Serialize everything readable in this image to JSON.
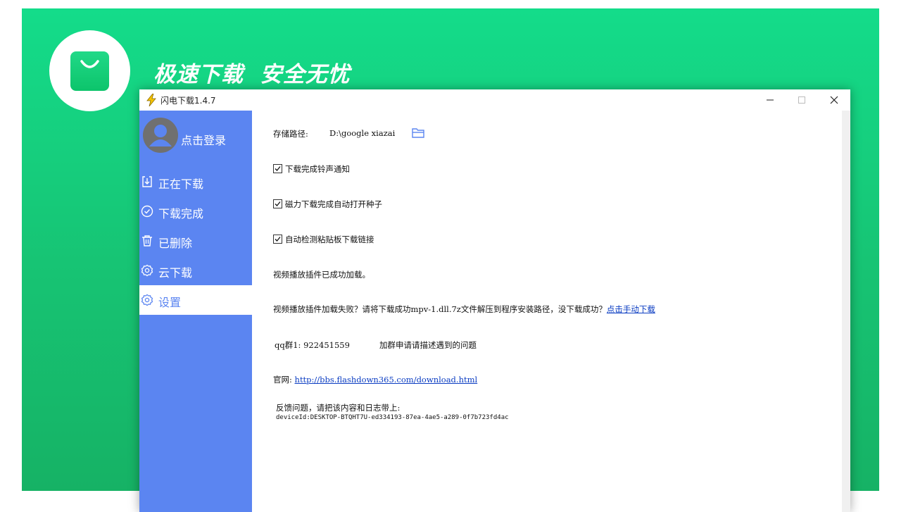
{
  "banner": {
    "slogan_part1": "极速下载",
    "slogan_part2": "安全无忧",
    "logo_icon": "shopping-bag-icon",
    "colors": {
      "banner_top": "#14dc8a",
      "banner_bottom": "#16b265",
      "logo_green": "#0cc46b"
    }
  },
  "window": {
    "title": "闪电下载1.4.7",
    "app_icon": "lightning-icon",
    "controls": [
      "minimize-icon",
      "maximize-icon",
      "close-icon"
    ]
  },
  "sidebar": {
    "login_label": "点击登录",
    "items": [
      {
        "label": "正在下载",
        "icon": "download-icon",
        "active": false
      },
      {
        "label": "下载完成",
        "icon": "check-circle-icon",
        "active": false
      },
      {
        "label": "已删除",
        "icon": "trash-icon",
        "active": false
      },
      {
        "label": "云下载",
        "icon": "gear-icon",
        "active": false
      },
      {
        "label": "设置",
        "icon": "gear-icon",
        "active": true
      }
    ],
    "colors": {
      "background": "#5b85f1",
      "active_bg": "#ffffff"
    }
  },
  "settings": {
    "path_label": "存储路径:",
    "path_value": "D:\\google xiazai",
    "folder_icon": "folder-open-icon",
    "options": [
      {
        "label": "下载完成铃声通知",
        "checked": true
      },
      {
        "label": "磁力下载完成自动打开种子",
        "checked": true
      },
      {
        "label": "自动检测粘贴板下载链接",
        "checked": true
      }
    ],
    "plugin_status": "视频播放插件已成功加载。",
    "plugin_fail_text": "视频播放插件加载失败？请将下载成功mpv-1.dll.7z文件解压到程序安装路径，没下载成功？",
    "plugin_fail_link": "点击手动下载",
    "qq_label": "qq群1:",
    "qq_number": "922451559",
    "qq_note": "加群申请请描述遇到的问题",
    "site_label": "官网:",
    "site_url": "http://bbs.flashdown365.com/download.html",
    "feedback_title": "反馈问题，请把该内容和日志带上:",
    "device_id": "deviceId:DESKTOP-BTQHT7U-ed334193-87ea-4ae5-a289-0f7b723fd4ac"
  }
}
